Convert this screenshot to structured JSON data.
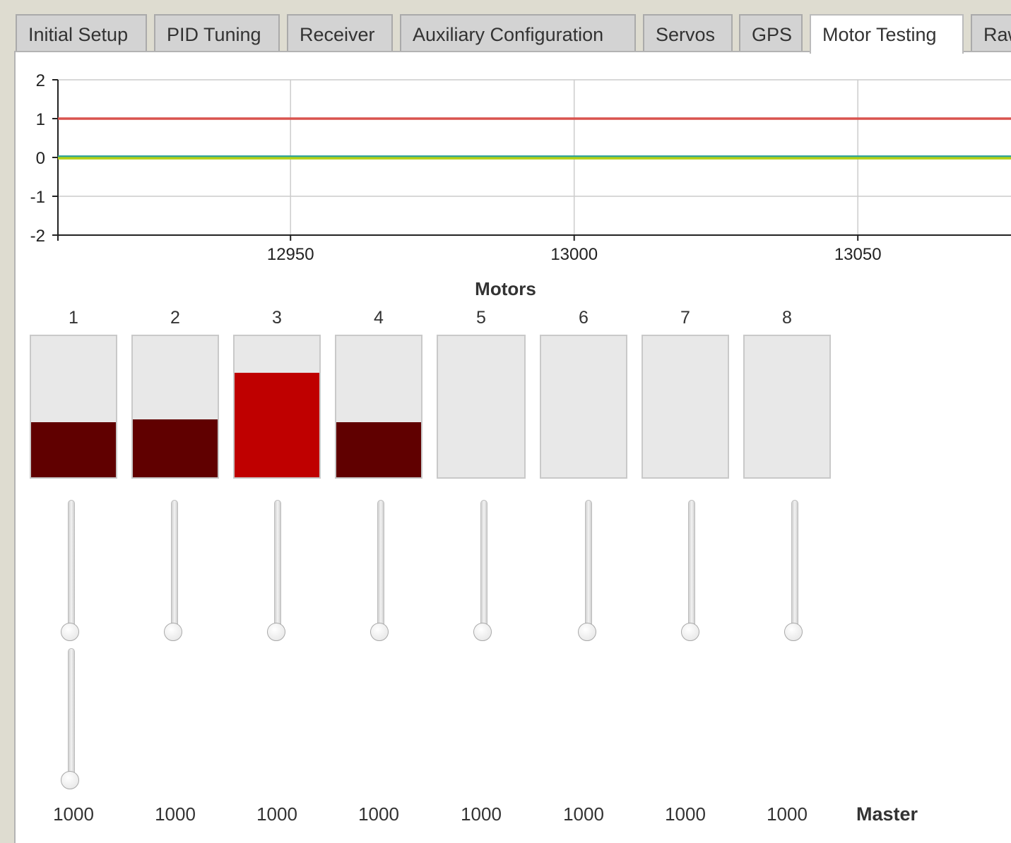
{
  "tabs": [
    {
      "label": "Initial Setup",
      "active": false
    },
    {
      "label": "PID Tuning",
      "active": false
    },
    {
      "label": "Receiver",
      "active": false
    },
    {
      "label": "Auxiliary Configuration",
      "active": false
    },
    {
      "label": "Servos",
      "active": false
    },
    {
      "label": "GPS",
      "active": false
    },
    {
      "label": "Motor Testing",
      "active": true
    },
    {
      "label": "Raw",
      "active": false
    }
  ],
  "chart_data": {
    "type": "line",
    "title": "",
    "xlabel": "",
    "ylabel": "",
    "x_ticks": [
      12950,
      13000,
      13050
    ],
    "y_ticks": [
      2,
      1,
      0,
      -1,
      -2
    ],
    "y_tick_labels": [
      "2",
      "1",
      "0",
      "-1",
      "-2"
    ],
    "xlim": [
      12909,
      13077
    ],
    "ylim": [
      -2,
      2
    ],
    "grid": true,
    "series": [
      {
        "color": "#d9534f",
        "x": [
          12909,
          12950,
          13000,
          13050,
          13077
        ],
        "y": [
          1.0,
          1.0,
          1.0,
          1.0,
          1.0
        ]
      },
      {
        "color": "#2aa198",
        "x": [
          12909,
          12950,
          13000,
          13050,
          13077
        ],
        "y": [
          0.02,
          0.02,
          0.02,
          0.02,
          0.02
        ]
      },
      {
        "color": "#b5d116",
        "x": [
          12909,
          12950,
          13000,
          13050,
          13077
        ],
        "y": [
          -0.02,
          -0.02,
          -0.02,
          -0.02,
          -0.02
        ]
      }
    ]
  },
  "motors": {
    "title": "Motors",
    "master_label": "Master",
    "items": [
      {
        "number": "1",
        "value": "1000",
        "level": 0.39,
        "color": "#600000"
      },
      {
        "number": "2",
        "value": "1000",
        "level": 0.41,
        "color": "#600000"
      },
      {
        "number": "3",
        "value": "1000",
        "level": 0.74,
        "color": "#bf0000"
      },
      {
        "number": "4",
        "value": "1000",
        "level": 0.39,
        "color": "#600000"
      },
      {
        "number": "5",
        "value": "1000",
        "level": 0.0,
        "color": "#600000"
      },
      {
        "number": "6",
        "value": "1000",
        "level": 0.0,
        "color": "#600000"
      },
      {
        "number": "7",
        "value": "1000",
        "level": 0.0,
        "color": "#600000"
      },
      {
        "number": "8",
        "value": "1000",
        "level": 0.0,
        "color": "#600000"
      }
    ],
    "slider_position": 0.0,
    "master_slider_position": 0.0
  }
}
